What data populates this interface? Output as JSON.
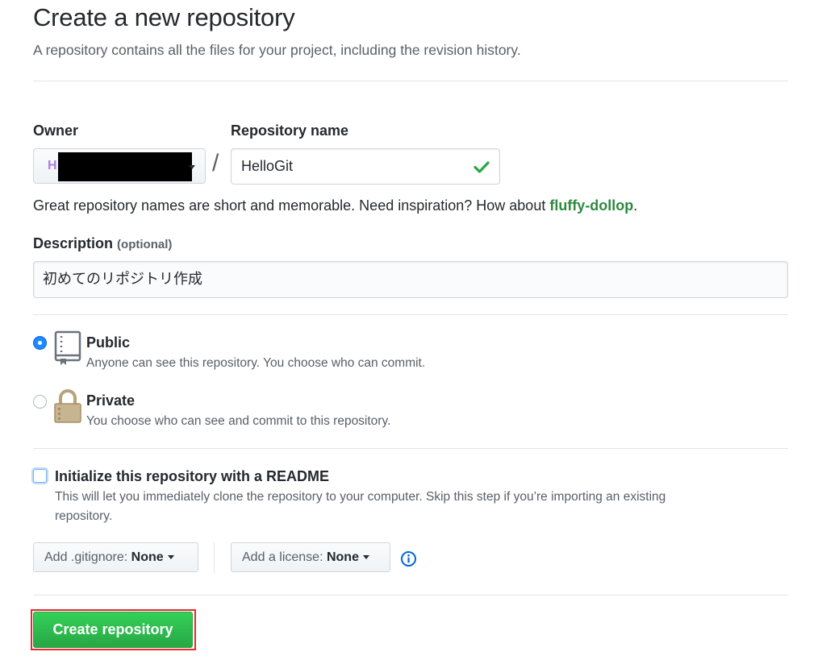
{
  "header": {
    "title": "Create a new repository",
    "subtitle": "A repository contains all the files for your project, including the revision history."
  },
  "owner": {
    "label": "Owner",
    "avatar_hint": "H",
    "value_redacted": true
  },
  "separator": "/",
  "repository": {
    "label": "Repository name",
    "value": "HelloGit",
    "valid": true
  },
  "hint": {
    "text": "Great repository names are short and memorable. Need inspiration? How about ",
    "suggestion": "fluffy-dollop",
    "end": "."
  },
  "description": {
    "label": "Description",
    "optional": "(optional)",
    "value": "初めてのリポジトリ作成"
  },
  "visibility": {
    "selected": "public",
    "public": {
      "title": "Public",
      "note": "Anyone can see this repository. You choose who can commit.",
      "icon": "repo-book-icon"
    },
    "private": {
      "title": "Private",
      "note": "You choose who can see and commit to this repository.",
      "icon": "lock-icon"
    }
  },
  "readme": {
    "title": "Initialize this repository with a README",
    "note_line1": "This will let you immediately clone the repository to your computer. Skip this step if you’re importing an existing",
    "note_line2": "repository.",
    "checked": false
  },
  "gitignore": {
    "label": "Add .gitignore:",
    "value": "None"
  },
  "license": {
    "label": "Add a license:",
    "value": "None"
  },
  "submit": {
    "label": "Create repository"
  },
  "colors": {
    "accent_green": "#28a745",
    "radio_blue": "#2188ff",
    "highlight_red": "#e32b2b",
    "lock_tan": "#b8a27a"
  }
}
